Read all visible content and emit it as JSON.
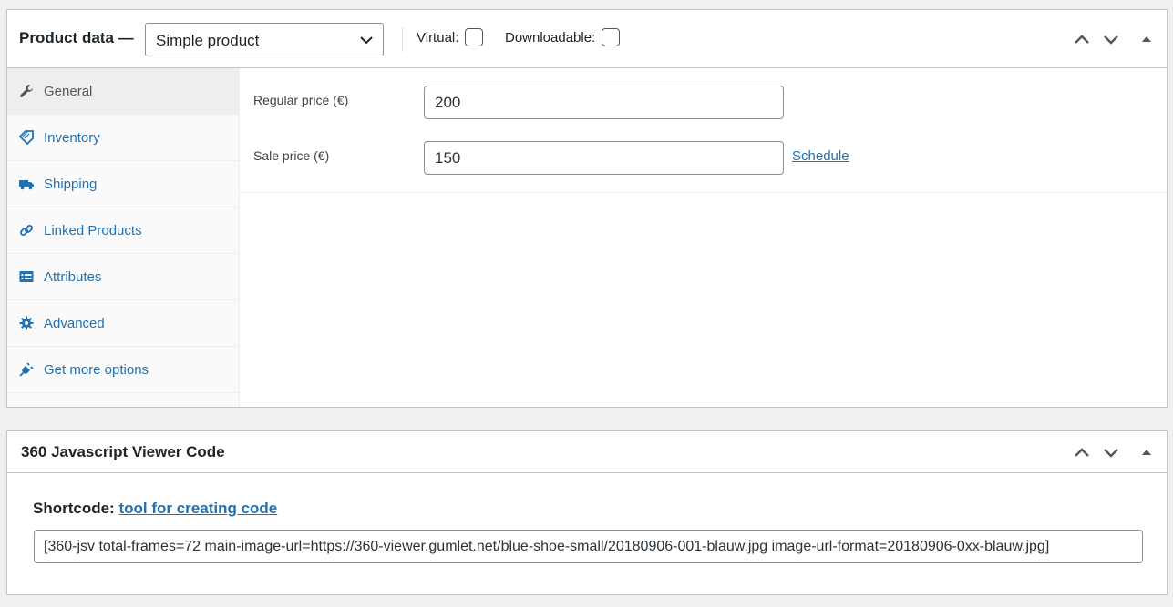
{
  "product_data": {
    "title": "Product data —",
    "product_type": "Simple product",
    "virtual_label": "Virtual:",
    "virtual_checked": false,
    "downloadable_label": "Downloadable:",
    "downloadable_checked": false,
    "tabs": [
      {
        "label": "General",
        "icon": "wrench-icon",
        "active": true
      },
      {
        "label": "Inventory",
        "icon": "tag-icon",
        "active": false
      },
      {
        "label": "Shipping",
        "icon": "truck-icon",
        "active": false
      },
      {
        "label": "Linked Products",
        "icon": "link-icon",
        "active": false
      },
      {
        "label": "Attributes",
        "icon": "list-icon",
        "active": false
      },
      {
        "label": "Advanced",
        "icon": "gear-icon",
        "active": false
      },
      {
        "label": "Get more options",
        "icon": "plug-icon",
        "active": false
      }
    ],
    "general": {
      "regular_price_label": "Regular price (€)",
      "regular_price": "200",
      "sale_price_label": "Sale price (€)",
      "sale_price": "150",
      "schedule_link": "Schedule"
    }
  },
  "viewer_box": {
    "title": "360 Javascript Viewer Code",
    "shortcode_label": "Shortcode:",
    "shortcode_link": "tool for creating code",
    "shortcode_value": "[360-jsv total-frames=72 main-image-url=https://360-viewer.gumlet.net/blue-shoe-small/20180906-001-blauw.jpg image-url-format=20180906-0xx-blauw.jpg]"
  },
  "colors": {
    "link": "#2271b1",
    "border": "#c3c4c7",
    "background": "#f0f0f1"
  }
}
